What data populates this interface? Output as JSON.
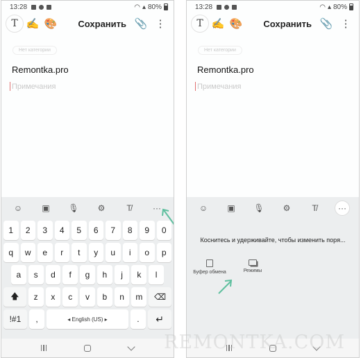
{
  "left": {
    "status": {
      "time": "13:28",
      "battery": "80%"
    },
    "toolbar": {
      "save_label": "Сохранить"
    },
    "editor": {
      "category": "Нет категории",
      "title": "Remontka.pro",
      "placeholder": "Примечания"
    },
    "keyboard": {
      "rows": [
        [
          "1",
          "2",
          "3",
          "4",
          "5",
          "6",
          "7",
          "8",
          "9",
          "0"
        ],
        [
          "q",
          "w",
          "e",
          "r",
          "t",
          "y",
          "u",
          "i",
          "o",
          "p"
        ],
        [
          "a",
          "s",
          "d",
          "f",
          "g",
          "h",
          "j",
          "k",
          "l"
        ],
        [
          "z",
          "x",
          "c",
          "v",
          "b",
          "n",
          "m"
        ]
      ],
      "symbols_label": "!#1",
      "comma_label": ",",
      "space_label": "◂ English (US) ▸",
      "period_label": "."
    }
  },
  "right": {
    "status": {
      "time": "13:28",
      "battery": "80%"
    },
    "toolbar": {
      "save_label": "Сохранить"
    },
    "editor": {
      "category": "Нет категории",
      "title": "Remontka.pro",
      "placeholder": "Примечания"
    },
    "panel": {
      "hint": "Коснитесь и удерживайте, чтобы изменить поря...",
      "clipboard_label": "Буфер обмена",
      "modes_label": "Режимы"
    }
  },
  "icons": {
    "toolbar": [
      "text-format-icon",
      "pen-icon",
      "palette-icon",
      "attach-icon",
      "more-vert-icon"
    ],
    "keyboard_toolbar": [
      "emoji-icon",
      "sticker-icon",
      "mic-icon",
      "settings-icon",
      "text-edit-icon",
      "more-horiz-icon"
    ]
  },
  "colors": {
    "accent_arrow": "#5fbf9f",
    "keyboard_bg": "#eceeef",
    "cursor": "#e07070"
  },
  "watermark": "REMONTKA.COM"
}
